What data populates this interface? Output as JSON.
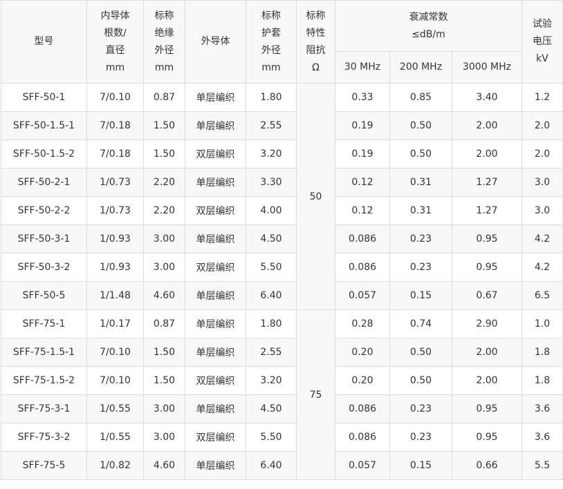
{
  "header": {
    "model": "型号",
    "inner_conductor": [
      "内导体",
      "根数/",
      "直径",
      "mm"
    ],
    "insulation_od": [
      "标称",
      "绝缘",
      "外径",
      "mm"
    ],
    "outer_conductor": "外导体",
    "jacket_od": [
      "标称",
      "护套",
      "外径",
      "mm"
    ],
    "impedance": [
      "标称",
      "特性",
      "阻抗",
      "Ω"
    ],
    "attenuation": [
      "衰减常数",
      "≤dB/m"
    ],
    "freq_30": "30 MHz",
    "freq_200": "200 MHz",
    "freq_3000": "3000 MHz",
    "test_voltage": [
      "试验",
      "电压",
      "kV"
    ]
  },
  "impedance_groups": [
    "50",
    "75"
  ],
  "rows": [
    [
      "SFF-50-1",
      "7/0.10",
      "0.87",
      "单层编织",
      "1.80",
      "0.33",
      "0.85",
      "3.40",
      "1.2"
    ],
    [
      "SFF-50-1.5-1",
      "7/0.18",
      "1.50",
      "单层编织",
      "2.55",
      "0.19",
      "0.50",
      "2.00",
      "2.0"
    ],
    [
      "SFF-50-1.5-2",
      "7/0.18",
      "1.50",
      "双层编织",
      "3.20",
      "0.19",
      "0.50",
      "2.00",
      "2.0"
    ],
    [
      "SFF-50-2-1",
      "1/0.73",
      "2.20",
      "单层编织",
      "3.30",
      "0.12",
      "0.31",
      "1.27",
      "3.0"
    ],
    [
      "SFF-50-2-2",
      "1/0.73",
      "2.20",
      "双层编织",
      "4.00",
      "0.12",
      "0.31",
      "1.27",
      "3.0"
    ],
    [
      "SFF-50-3-1",
      "1/0.93",
      "3.00",
      "单层编织",
      "4.50",
      "0.086",
      "0.23",
      "0.95",
      "4.2"
    ],
    [
      "SFF-50-3-2",
      "1/0.93",
      "3.00",
      "双层编织",
      "5.50",
      "0.086",
      "0.23",
      "0.95",
      "4.2"
    ],
    [
      "SFF-50-5",
      "1/1.48",
      "4.60",
      "单层编织",
      "6.40",
      "0.057",
      "0.15",
      "0.67",
      "6.5"
    ],
    [
      "SFF-75-1",
      "1/0.17",
      "0.87",
      "单层编织",
      "1.80",
      "0.28",
      "0.74",
      "2.90",
      "1.0"
    ],
    [
      "SFF-75-1.5-1",
      "7/0.10",
      "1.50",
      "单层编织",
      "2.55",
      "0.20",
      "0.50",
      "2.00",
      "1.8"
    ],
    [
      "SFF-75-1.5-2",
      "7/0.10",
      "1.50",
      "双层编织",
      "3.20",
      "0.20",
      "0.50",
      "2.00",
      "1.8"
    ],
    [
      "SFF-75-3-1",
      "1/0.55",
      "3.00",
      "单层编织",
      "4.50",
      "0.086",
      "0.23",
      "0.95",
      "3.6"
    ],
    [
      "SFF-75-3-2",
      "1/0.55",
      "3.00",
      "双层编织",
      "5.50",
      "0.086",
      "0.23",
      "0.95",
      "3.6"
    ],
    [
      "SFF-75-5",
      "1/0.82",
      "4.60",
      "单层编织",
      "6.40",
      "0.057",
      "0.15",
      "0.66",
      "5.5"
    ]
  ]
}
